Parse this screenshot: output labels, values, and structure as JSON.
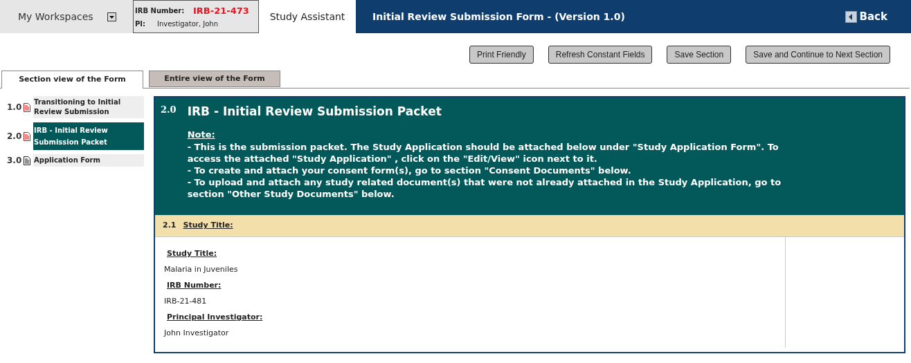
{
  "header": {
    "workspaces": "My Workspaces",
    "irb_label": "IRB Number:",
    "irb_number": "IRB-21-473",
    "pi_label": "PI:",
    "pi_name": "Investigator, John",
    "assistant": "Study Assistant",
    "title": "Initial Review Submission Form - (Version 1.0)",
    "back": "Back"
  },
  "actions": [
    "Print Friendly",
    "Refresh Constant Fields",
    "Save Section",
    "Save and Continue to Next Section"
  ],
  "tabs": [
    {
      "label": "Section view of the Form",
      "selected": true
    },
    {
      "label": "Entire view of the Form",
      "selected": false
    }
  ],
  "sections": [
    {
      "number": "1.0",
      "label": "Transitioning to Initial Review Submission",
      "selected": false,
      "flagged": true
    },
    {
      "number": "2.0",
      "label": "IRB - Initial Review Submission Packet",
      "selected": true,
      "flagged": true
    },
    {
      "number": "3.0",
      "label": "Application Form",
      "selected": false,
      "flagged": false
    }
  ],
  "panel": {
    "number": "2.0",
    "title": "IRB - Initial Review Submission Packet",
    "note_label": "Note:",
    "note_lines": [
      "- This is the submission packet. The Study Application should be attached below under \"Study Application Form\". To access the attached \"Study Application\" , click on the \"Edit/View\" icon next to it.",
      "- To create and attach your consent form(s), go to section \"Consent Documents\" below.",
      "- To upload and attach any study related document(s) that were not already attached in the Study Application, go to section \"Other Study Documents\" below."
    ]
  },
  "subsection": {
    "number": "2.1",
    "title": "Study Title:",
    "fields": [
      {
        "label": "Study Title:",
        "value": "Malaria in Juveniles"
      },
      {
        "label": "IRB Number:",
        "value": "IRB-21-481"
      },
      {
        "label": "Principal Investigator:",
        "value": "John Investigator"
      }
    ]
  }
}
